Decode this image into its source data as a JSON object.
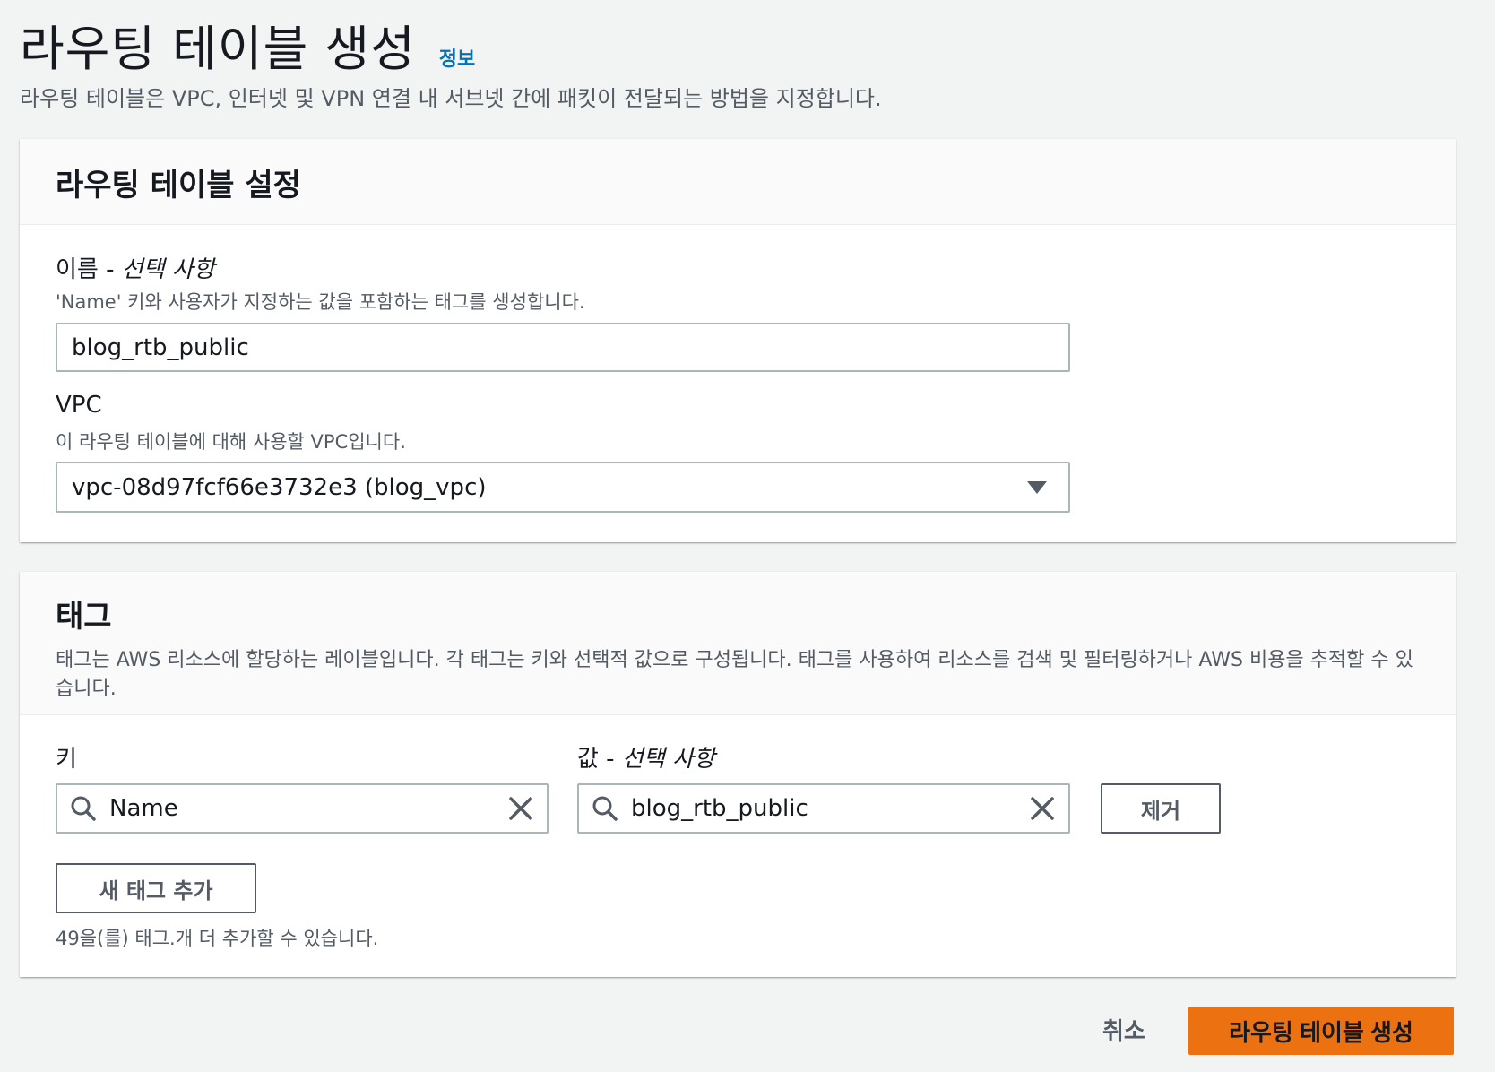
{
  "header": {
    "title": "라우팅 테이블 생성",
    "info_link": "정보",
    "description": "라우팅 테이블은 VPC, 인터넷 및 VPN 연결 내 서브넷 간에 패킷이 전달되는 방법을 지정합니다."
  },
  "settings_panel": {
    "title": "라우팅 테이블 설정",
    "name_field": {
      "label": "이름 - ",
      "label_optional": "선택 사항",
      "description": "'Name' 키와 사용자가 지정하는 값을 포함하는 태그를 생성합니다.",
      "value": "blog_rtb_public"
    },
    "vpc_field": {
      "label": "VPC",
      "description": "이 라우팅 테이블에 대해 사용할 VPC입니다.",
      "selected": "vpc-08d97fcf66e3732e3 (blog_vpc)"
    }
  },
  "tags_panel": {
    "title": "태그",
    "description": "태그는 AWS 리소스에 할당하는 레이블입니다. 각 태그는 키와 선택적 값으로 구성됩니다. 태그를 사용하여 리소스를 검색 및 필터링하거나 AWS 비용을 추적할 수 있습니다.",
    "key_label": "키",
    "value_label": "값 - ",
    "value_label_optional": "선택 사항",
    "tag_key": "Name",
    "tag_value": "blog_rtb_public",
    "remove_button": "제거",
    "add_button": "새 태그 추가",
    "limit_text": "49을(를) 태그.개 더 추가할 수 있습니다."
  },
  "footer": {
    "cancel": "취소",
    "submit": "라우팅 테이블 생성"
  },
  "icons": {
    "search": "search-icon",
    "clear": "close-icon",
    "dropdown": "caret-down-icon"
  },
  "colors": {
    "primary": "#ec7211",
    "link": "#0073bb",
    "background": "#f2f3f3"
  }
}
